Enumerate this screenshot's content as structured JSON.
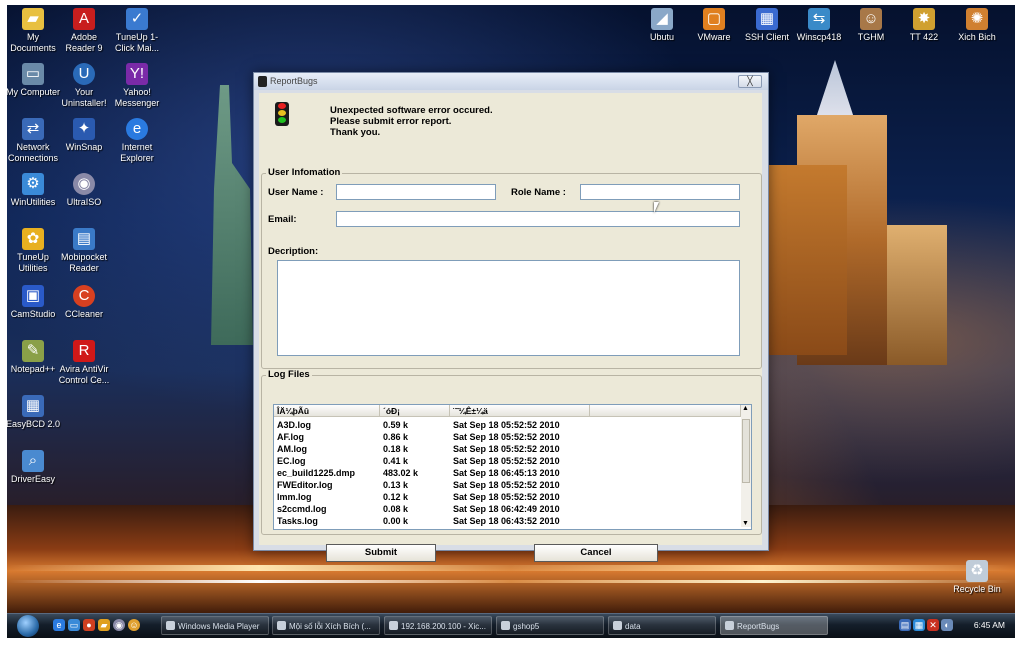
{
  "desktop_icons_left": [
    {
      "label": "My Documents",
      "icon": "folder-icon",
      "color": "#e8c040"
    },
    {
      "label": "Adobe Reader 9",
      "icon": "adobe-reader-icon",
      "color": "#c81e1e"
    },
    {
      "label": "TuneUp 1-Click Mai...",
      "icon": "tuneup-oneclick-icon",
      "color": "#3a7ad0"
    },
    {
      "label": "My Computer",
      "icon": "computer-icon",
      "color": "#6a8aa8"
    },
    {
      "label": "Your Uninstaller!",
      "icon": "uninstaller-icon",
      "color": "#2a6ab8"
    },
    {
      "label": "Yahoo! Messenger",
      "icon": "yahoo-messenger-icon",
      "color": "#7a2aa8"
    },
    {
      "label": "Network Connections",
      "icon": "network-icon",
      "color": "#3a6ab8"
    },
    {
      "label": "WinSnap",
      "icon": "winsnap-icon",
      "color": "#2a5ab0"
    },
    {
      "label": "Internet Explorer",
      "icon": "internet-explorer-icon",
      "color": "#2a7ae0"
    },
    {
      "label": "WinUtilities",
      "icon": "winutilities-icon",
      "color": "#3a8ad8"
    },
    {
      "label": "UltraISO",
      "icon": "ultraiso-icon",
      "color": "#8a8aa8"
    },
    {
      "label": "TuneUp Utilities",
      "icon": "tuneup-utilities-icon",
      "color": "#e8b020"
    },
    {
      "label": "Mobipocket Reader",
      "icon": "mobipocket-icon",
      "color": "#3a7ac8"
    },
    {
      "label": "CamStudio",
      "icon": "camstudio-icon",
      "color": "#2a5ac8"
    },
    {
      "label": "CCleaner",
      "icon": "ccleaner-icon",
      "color": "#d84020"
    },
    {
      "label": "Notepad++",
      "icon": "notepad-icon",
      "color": "#8aa048"
    },
    {
      "label": "Avira AntiVir Control Ce...",
      "icon": "avira-icon",
      "color": "#d01818"
    },
    {
      "label": "EasyBCD 2.0",
      "icon": "easybcd-icon",
      "color": "#3a6ab8"
    },
    {
      "label": "DriverEasy",
      "icon": "drivereasy-icon",
      "color": "#4a8ad0"
    }
  ],
  "desktop_icons_top": [
    {
      "label": "Ubutu",
      "icon": "ubuntu-icon",
      "color": "#8aa8c8"
    },
    {
      "label": "VMware",
      "icon": "vmware-icon",
      "color": "#e08020"
    },
    {
      "label": "SSH Client",
      "icon": "ssh-client-icon",
      "color": "#3a6ad0"
    },
    {
      "label": "Winscp418",
      "icon": "winscp-icon",
      "color": "#3a8ac8"
    },
    {
      "label": "TGHM",
      "icon": "tghm-icon",
      "color": "#a87848"
    },
    {
      "label": "TT 422",
      "icon": "tt422-icon",
      "color": "#d0a030"
    },
    {
      "label": "Xich Bich",
      "icon": "xich-bich-icon",
      "color": "#d08030"
    }
  ],
  "recycle_bin": {
    "label": "Recycle Bin",
    "icon": "recycle-bin-icon"
  },
  "dialog": {
    "title": "ReportBugs",
    "close_label": "╳",
    "message": [
      "Unexpected software error occured.",
      "Please submit error report.",
      "Thank you."
    ],
    "user_info": {
      "legend": "User Infomation",
      "user_name_label": "User Name :",
      "user_name_value": "",
      "role_name_label": "Role Name :",
      "role_name_value": "",
      "email_label": "Email:",
      "email_value": "",
      "description_label": "Decription:",
      "description_value": ""
    },
    "log_files": {
      "legend": "Log Files",
      "columns": [
        "ÎÄ¼þÃû",
        "´óÐ¡",
        "¨˜¼­Ê±¼ä"
      ],
      "rows": [
        [
          "A3D.log",
          "0.59 k",
          "Sat Sep 18 05:52:52 2010"
        ],
        [
          "AF.log",
          "0.86 k",
          "Sat Sep 18 05:52:52 2010"
        ],
        [
          "AM.log",
          "0.18 k",
          "Sat Sep 18 05:52:52 2010"
        ],
        [
          "EC.log",
          "0.41 k",
          "Sat Sep 18 05:52:52 2010"
        ],
        [
          "ec_build1225.dmp",
          "483.02 k",
          "Sat Sep 18 06:45:13 2010"
        ],
        [
          "FWEditor.log",
          "0.13 k",
          "Sat Sep 18 05:52:52 2010"
        ],
        [
          "lmm.log",
          "0.12 k",
          "Sat Sep 18 05:52:52 2010"
        ],
        [
          "s2ccmd.log",
          "0.08 k",
          "Sat Sep 18 06:42:49 2010"
        ],
        [
          "Tasks.log",
          "0.00 k",
          "Sat Sep 18 06:43:52 2010"
        ]
      ]
    },
    "submit_label": "Submit",
    "cancel_label": "Cancel"
  },
  "taskbar": {
    "buttons": [
      {
        "label": "Windows Media Player",
        "icon": "media-player-icon"
      },
      {
        "label": "Mội số lỗi Xích Bích (...",
        "icon": "firefox-icon"
      },
      {
        "label": "192.168.200.100 - Xic...",
        "icon": "remote-desktop-icon"
      },
      {
        "label": "gshop5",
        "icon": "folder-icon"
      },
      {
        "label": "data",
        "icon": "folder-icon"
      },
      {
        "label": "ReportBugs",
        "icon": "reportbugs-icon"
      }
    ],
    "clock": "6:45 AM"
  }
}
